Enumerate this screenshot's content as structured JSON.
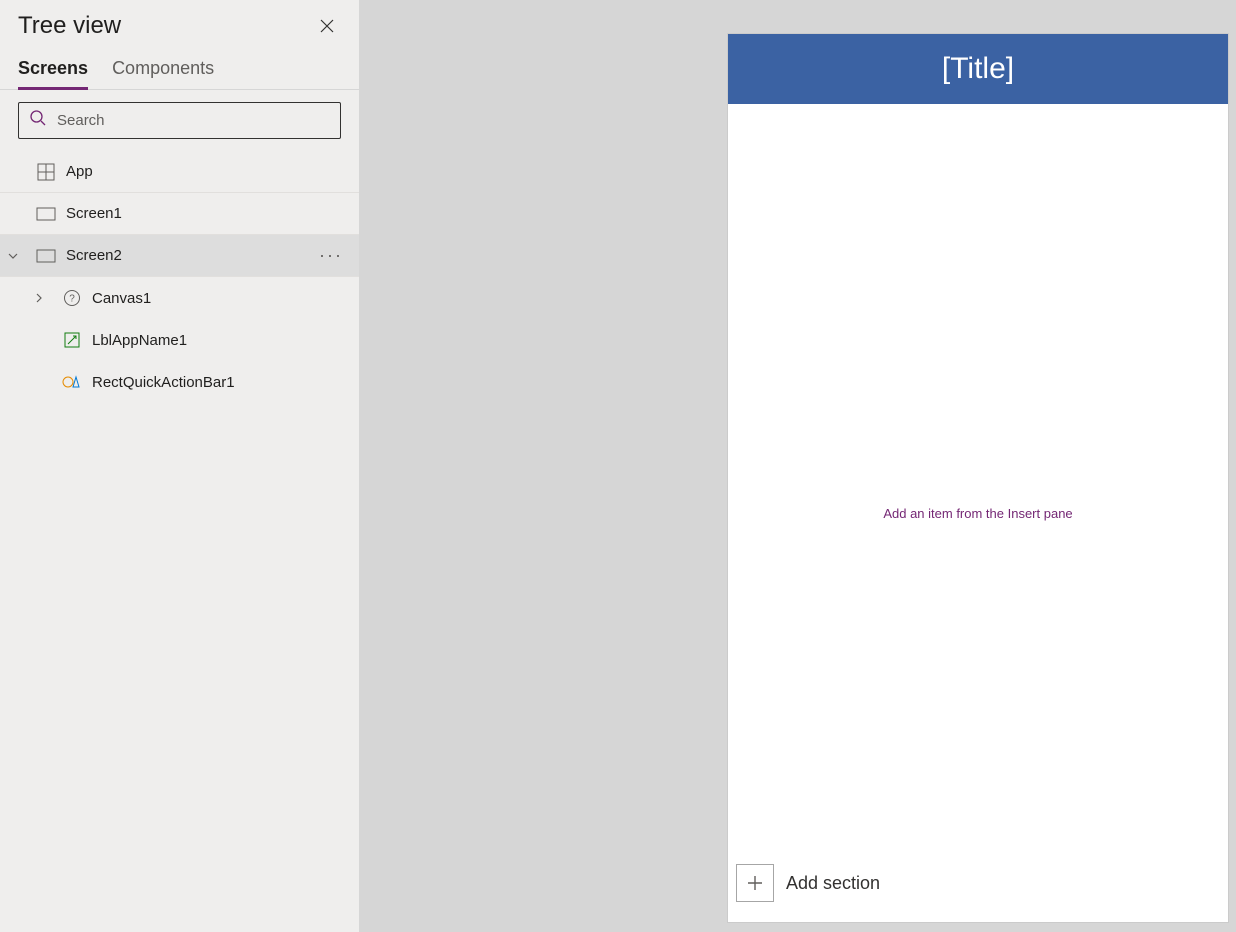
{
  "panel": {
    "title": "Tree view",
    "tabs": {
      "screens": "Screens",
      "components": "Components"
    },
    "search_placeholder": "Search"
  },
  "tree": {
    "app": "App",
    "screen1": "Screen1",
    "screen2": "Screen2",
    "canvas1": "Canvas1",
    "lblAppName1": "LblAppName1",
    "rectQuickActionBar1": "RectQuickActionBar1"
  },
  "canvas": {
    "title": "[Title]",
    "hint": "Add an item from the Insert pane",
    "add_section": "Add section"
  }
}
